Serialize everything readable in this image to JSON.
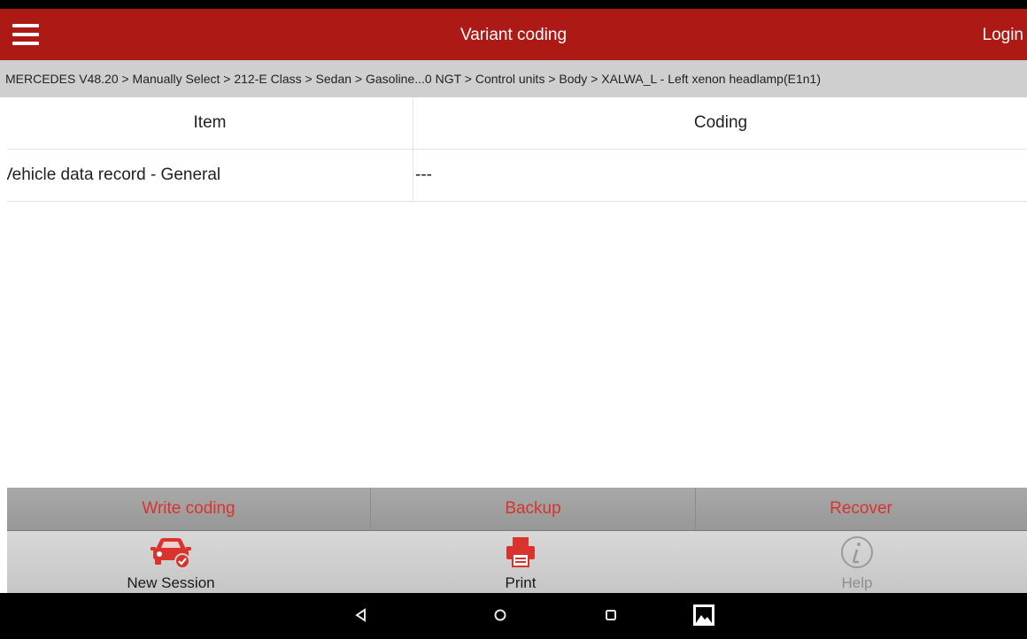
{
  "header": {
    "title": "Variant coding",
    "login_label": "Login"
  },
  "breadcrumb": "MERCEDES V48.20 > Manually Select > 212-E Class > Sedan > Gasoline...0 NGT > Control units > Body > XALWA_L - Left xenon headlamp(E1n1)",
  "table": {
    "columns": [
      "Item",
      "Coding"
    ],
    "rows": [
      {
        "item": "Vehicle data record - General",
        "coding": "---"
      }
    ]
  },
  "actions": {
    "write_coding": "Write coding",
    "backup": "Backup",
    "recover": "Recover"
  },
  "toolbar": {
    "new_session": "New Session",
    "print": "Print",
    "help": "Help"
  },
  "icons": {
    "menu": "hamburger-icon",
    "new_session": "car-icon",
    "print": "printer-icon",
    "help": "info-icon",
    "back": "back-triangle-icon",
    "home": "home-circle-icon",
    "recents": "recents-square-icon",
    "gallery": "gallery-icon"
  },
  "colors": {
    "header_bg": "#ad1915",
    "accent_red": "#d8332d",
    "breadcrumb_bg": "#cfcfcf",
    "action_bar_bg": "#a3a3a3",
    "toolbar_bg": "#cfcfcf",
    "help_gray": "#8f8f8f"
  }
}
